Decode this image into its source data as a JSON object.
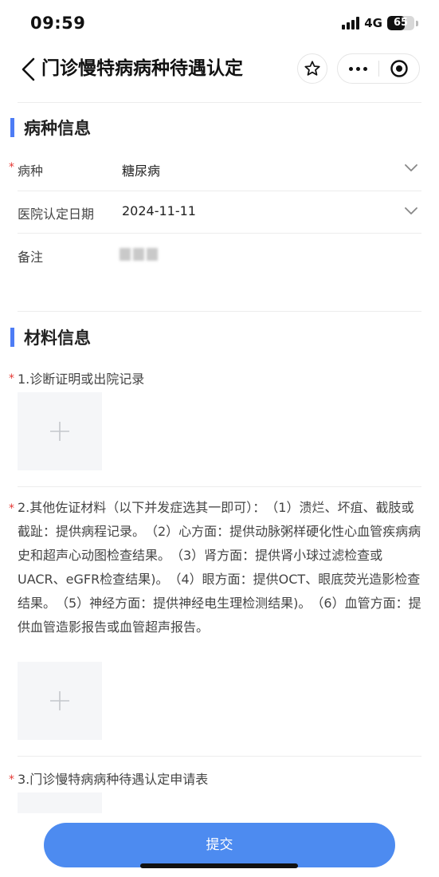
{
  "status": {
    "time": "09:59",
    "network": "4G",
    "battery": "65",
    "battery_level": 0.65
  },
  "nav": {
    "title": "门诊慢特病病种待遇认定",
    "icons": [
      "chevron-left-icon",
      "star-icon",
      "more-dots-icon",
      "target-icon"
    ]
  },
  "disease_section": {
    "title": "病种信息",
    "fields": [
      {
        "label": "病种",
        "required": true,
        "value": "糖尿病"
      },
      {
        "label": "医院认定日期",
        "required": false,
        "value": "2024-11-11"
      },
      {
        "label": "备注",
        "required": false,
        "value": ""
      }
    ]
  },
  "material_section": {
    "title": "材料信息",
    "items": [
      {
        "label": "1.诊断证明或出院记录",
        "required": true
      },
      {
        "label": "2.其他佐证材料（以下并发症选其一即可）：　（1）溃烂、坏疽、截肢或截趾：提供病程记录。　（2）心方面：提供动脉粥样硬化性心血管疾病病史和超声心动图检查结果。　（3）肾方面：提供肾小球过滤检查或UACR、eGFR检查结果)。　（4）眼方面：提供OCT、眼底荧光造影检查结果。　（5）神经方面：提供神经电生理检测结果)。　（6）血管方面：提供血管造影报告或血管超声报告。",
        "required": true
      },
      {
        "label": "3.门诊慢特病病种待遇认定申请表",
        "required": true
      }
    ]
  },
  "submit_label": "提交",
  "colors": {
    "accent": "#4d7cf5",
    "submit": "#4d8bf0",
    "required": "#e53935"
  }
}
